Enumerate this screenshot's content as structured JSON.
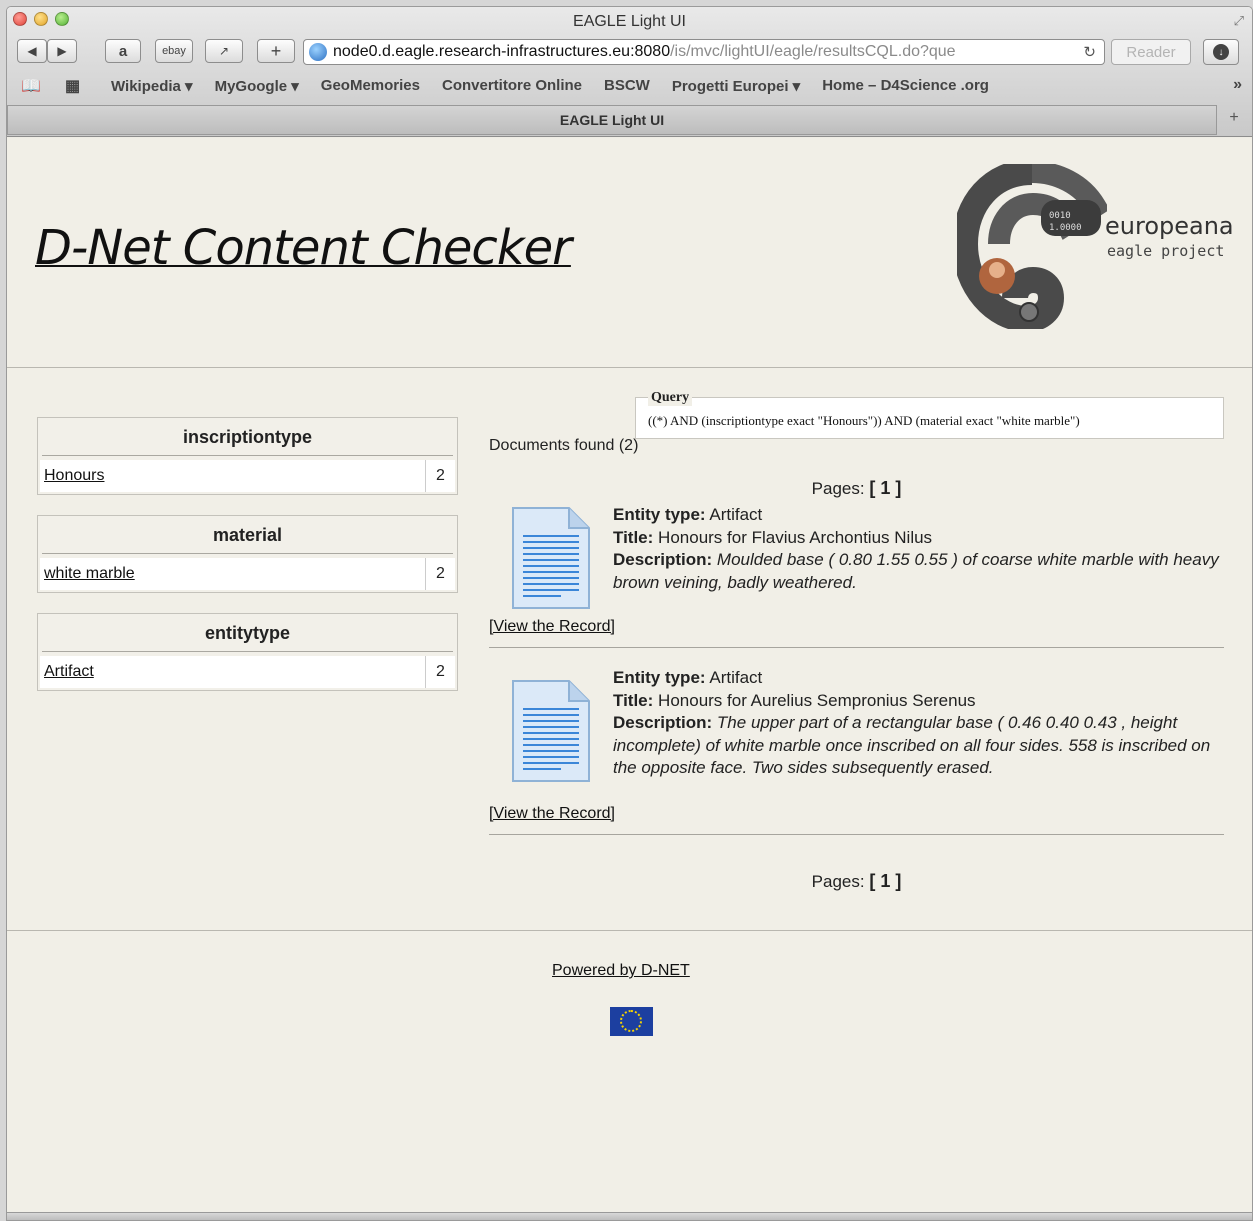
{
  "window": {
    "title": "EAGLE Light UI"
  },
  "toolbar": {
    "back": "◀",
    "forward": "▶",
    "amazon": "a",
    "ebay": "ebay",
    "share": "↗",
    "add": "+",
    "url_main": "node0.d.eagle.research-infrastructures.eu:8080",
    "url_rest": "/is/mvc/lightUI/eagle/resultsCQL.do?que",
    "reader": "Reader"
  },
  "bookmarks": {
    "items": [
      "Wikipedia ▾",
      "MyGoogle ▾",
      "GeoMemories",
      "Convertitore Online",
      "BSCW",
      "Progetti Europei ▾",
      "Home – D4Science .org"
    ],
    "more": "»"
  },
  "tab": {
    "label": "EAGLE Light UI",
    "new_tab": "+"
  },
  "header": {
    "title": "D-Net Content Checker",
    "logo_line1": "europeana",
    "logo_line2": "eagle project"
  },
  "facets": [
    {
      "title": "inscriptiontype",
      "value": "Honours",
      "count": "2"
    },
    {
      "title": "material",
      "value": "white marble",
      "count": "2"
    },
    {
      "title": "entitytype",
      "value": "Artifact",
      "count": "2"
    }
  ],
  "query": {
    "legend": "Query",
    "text": "((*) AND (inscriptiontype exact \"Honours\")) AND (material exact \"white marble\")"
  },
  "results": {
    "docs_found": "Documents found (2)",
    "pages_label": "Pages:",
    "pages_value": "[ 1 ]",
    "entity_label": "Entity type:",
    "title_label": "Title:",
    "desc_label": "Description:",
    "view_label": "[View the Record]",
    "items": [
      {
        "entity": "Artifact",
        "title": "Honours for Flavius Archontius Nilus",
        "description": "Moulded base ( 0.80 1.55 0.55 ) of coarse white marble with heavy brown veining, badly weathered."
      },
      {
        "entity": "Artifact",
        "title": "Honours for Aurelius Sempronius Serenus",
        "description": "The upper part of a rectangular base ( 0.46 0.40 0.43 , height incomplete) of white marble once inscribed on all four sides. 558 is inscribed on the opposite face. Two sides subsequently erased."
      }
    ]
  },
  "footer": {
    "powered": "Powered by D-NET"
  }
}
